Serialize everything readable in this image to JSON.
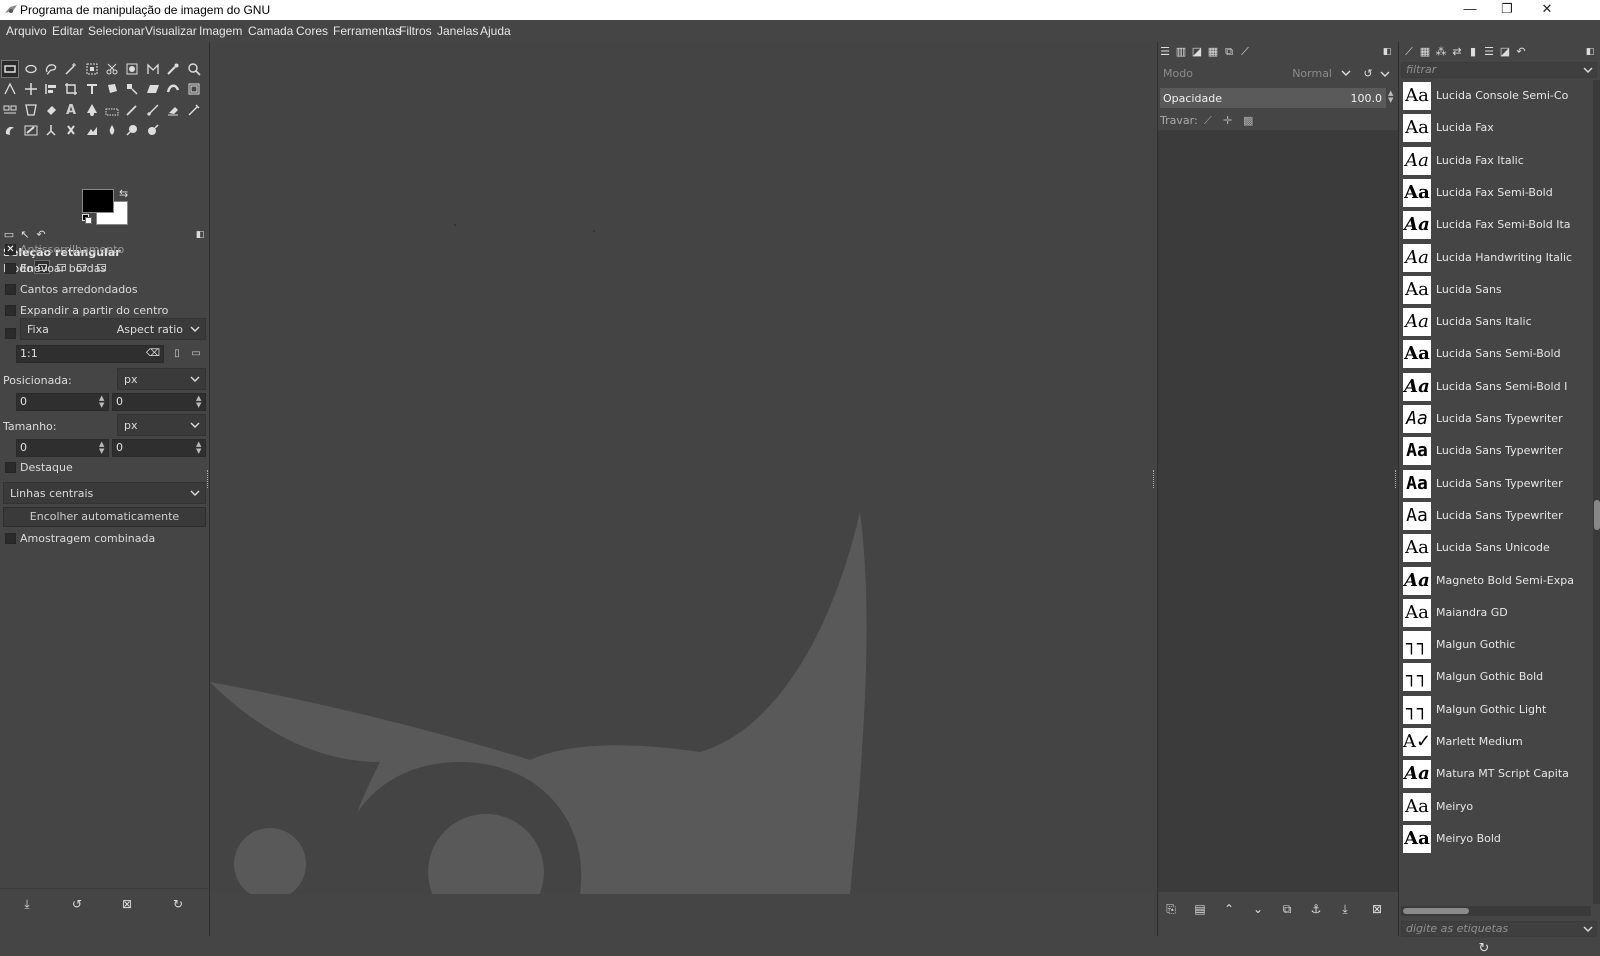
{
  "window": {
    "title": "Programa de manipulação de imagem do GNU",
    "minimize_glyph": "—",
    "maximize_glyph": "❐",
    "close_glyph": "✕"
  },
  "menu": [
    "Arquivo",
    "Editar",
    "Selecionar",
    "Visualizar",
    "Imagem",
    "Camada",
    "Cores",
    "Ferramentas",
    "Filtros",
    "Janelas",
    "Ajuda"
  ],
  "tool_options": {
    "title": "Seleção retangular",
    "mode_label": "Modo:",
    "antialias": "Antisserrilhamento",
    "feather": "Enevoar bordas",
    "rounded": "Cantos arredondados",
    "expand_center": "Expandir a partir do centro",
    "fixed_label": "Fixa",
    "fixed_value": "Aspect ratio",
    "ratio_value": "1:1",
    "position_label": "Posicionada:",
    "position_unit": "px",
    "pos_x": "0",
    "pos_y": "0",
    "size_label": "Tamanho:",
    "size_unit": "px",
    "size_w": "0",
    "size_h": "0",
    "highlight": "Destaque",
    "guides": "Linhas centrais",
    "autoshrink": "Encolher automaticamente",
    "sample_merged": "Amostragem combinada",
    "antialias_checked": "✕"
  },
  "layers": {
    "mode_label": "Modo",
    "mode_value": "Normal",
    "opacity_label": "Opacidade",
    "opacity_value": "100.0",
    "lock_label": "Travar:"
  },
  "fonts": {
    "filter_placeholder": "filtrar",
    "tags_placeholder": "digite as etiquetas",
    "items": [
      {
        "name": "Lucida Console Semi-Co",
        "glyph": "Aa"
      },
      {
        "name": "Lucida Fax",
        "glyph": "Aa"
      },
      {
        "name": "Lucida Fax Italic",
        "glyph": "Aa"
      },
      {
        "name": "Lucida Fax Semi-Bold",
        "glyph": "Aa"
      },
      {
        "name": "Lucida Fax Semi-Bold Ita",
        "glyph": "Aa"
      },
      {
        "name": "Lucida Handwriting Italic",
        "glyph": "Aa"
      },
      {
        "name": "Lucida Sans",
        "glyph": "Aa"
      },
      {
        "name": "Lucida Sans Italic",
        "glyph": "Aa"
      },
      {
        "name": "Lucida Sans Semi-Bold",
        "glyph": "Aa"
      },
      {
        "name": "Lucida Sans Semi-Bold I",
        "glyph": "Aa"
      },
      {
        "name": "Lucida Sans Typewriter",
        "glyph": "Aa"
      },
      {
        "name": "Lucida Sans Typewriter",
        "glyph": "Aa"
      },
      {
        "name": "Lucida Sans Typewriter",
        "glyph": "Aa"
      },
      {
        "name": "Lucida Sans Typewriter",
        "glyph": "Aa"
      },
      {
        "name": "Lucida Sans Unicode",
        "glyph": "Aa"
      },
      {
        "name": "Magneto Bold Semi-Expa",
        "glyph": "Aa"
      },
      {
        "name": "Maiandra GD",
        "glyph": "Aa"
      },
      {
        "name": "Malgun Gothic",
        "glyph": "┐┐"
      },
      {
        "name": "Malgun Gothic Bold",
        "glyph": "┐┐"
      },
      {
        "name": "Malgun Gothic Light",
        "glyph": "┐┐"
      },
      {
        "name": "Marlett Medium",
        "glyph": "A✓"
      },
      {
        "name": "Matura MT Script Capita",
        "glyph": "Aa"
      },
      {
        "name": "Meiryo",
        "glyph": "Aa"
      },
      {
        "name": "Meiryo Bold",
        "glyph": "Aa"
      }
    ]
  },
  "colors": {
    "background": "#454545",
    "canvas_logo": "#5a5a5a",
    "canvas_dark": "#3d3d3d"
  }
}
